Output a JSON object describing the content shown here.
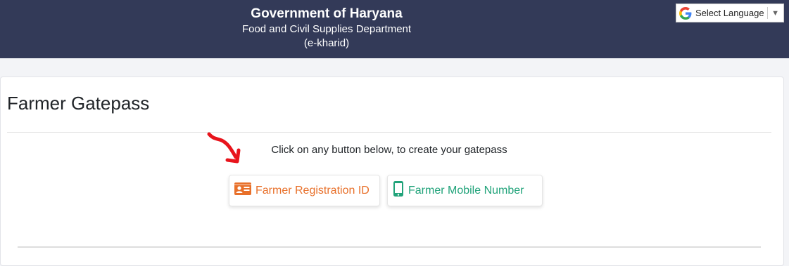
{
  "header": {
    "title": "Government of Haryana",
    "department": "Food and Civil Supplies Department",
    "portal": "(e-kharid)"
  },
  "language_selector": {
    "label": "Select Language",
    "icon": "google-g-icon",
    "arrow": "▼"
  },
  "main": {
    "page_title": "Farmer Gatepass",
    "instruction": "Click on any button below, to create your gatepass",
    "buttons": [
      {
        "label": "Farmer Registration ID",
        "icon": "id-card-icon",
        "color": "#e8702a"
      },
      {
        "label": "Farmer Mobile Number",
        "icon": "mobile-phone-icon",
        "color": "#21a37a"
      }
    ]
  },
  "colors": {
    "header_bg": "#333a58",
    "annotation_arrow": "#e8141c"
  }
}
